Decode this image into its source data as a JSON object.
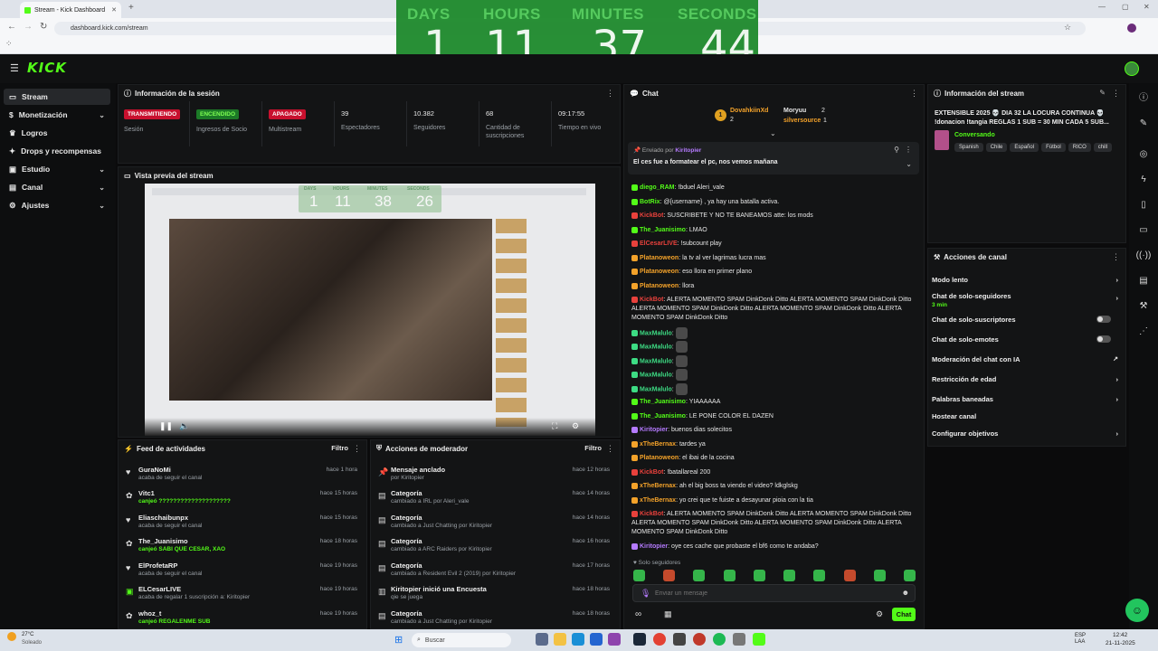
{
  "browser": {
    "tab_title": "Stream - Kick Dashboard",
    "url": "dashboard.kick.com/stream"
  },
  "timer": {
    "labels": [
      "DAYS",
      "HOURS",
      "MINUTES",
      "SECONDS"
    ],
    "values": [
      "1",
      "11",
      "37",
      "44"
    ]
  },
  "logo": "KICK",
  "sidebar": {
    "items": [
      {
        "label": "Stream"
      },
      {
        "label": "Monetización"
      },
      {
        "label": "Logros"
      },
      {
        "label": "Drops y recompensas"
      },
      {
        "label": "Estudio"
      },
      {
        "label": "Canal"
      },
      {
        "label": "Ajustes"
      }
    ]
  },
  "session": {
    "title": "Información de la sesión",
    "cols": [
      {
        "badge": "TRANSMITIENDO",
        "label": "Sesión"
      },
      {
        "badge": "ENCENDIDO",
        "label": "Ingresos de Socio"
      },
      {
        "badge": "APAGADO",
        "label": "Multistream"
      },
      {
        "value": "39",
        "label": "Espectadores"
      },
      {
        "value": "10.382",
        "label": "Seguidores"
      },
      {
        "value": "68",
        "label": "Cantidad de suscripciones"
      },
      {
        "value": "09:17:55",
        "label": "Tiempo en vivo"
      }
    ]
  },
  "preview": {
    "title": "Vista previa del stream",
    "mini_timer": [
      "1",
      "11",
      "38",
      "26"
    ],
    "mini_labels": [
      "DAYS",
      "HOURS",
      "MINUTES",
      "SECONDS"
    ]
  },
  "activity": {
    "title": "Feed de actividades",
    "filter": "Filtro",
    "rows": [
      {
        "name": "GuraNoMi",
        "sub": "acaba de seguir el canal",
        "time": "hace 1 hora"
      },
      {
        "name": "Vitc1",
        "sub": "canjeó ????????????????????",
        "time": "hace 15 horas"
      },
      {
        "name": "Eliaschaibunpx",
        "sub": "acaba de seguir el canal",
        "time": "hace 15 horas"
      },
      {
        "name": "The_Juanisimo",
        "sub": "canjeó SABI QUE CESAR, XAO",
        "time": "hace 18 horas"
      },
      {
        "name": "ElProfetaRP",
        "sub": "acaba de seguir el canal",
        "time": "hace 19 horas"
      },
      {
        "name": "ELCesarLIVE",
        "sub": "acaba de regalar 1 suscripción a: Kiritopier",
        "time": "hace 19 horas"
      },
      {
        "name": "whoz_t",
        "sub": "canjeó REGALENME SUB",
        "time": "hace 19 horas"
      }
    ]
  },
  "modactions": {
    "title": "Acciones de moderador",
    "filter": "Filtro",
    "rows": [
      {
        "name": "Mensaje anclado",
        "sub": "por Kiritopier",
        "time": "hace 12 horas"
      },
      {
        "name": "Categoría",
        "sub": "cambiado a IRL por Aleri_vale",
        "time": "hace 14 horas"
      },
      {
        "name": "Categoría",
        "sub": "cambiado a Just Chatting por Kiritopier",
        "time": "hace 14 horas"
      },
      {
        "name": "Categoría",
        "sub": "cambiado a ARC Raiders por Kiritopier",
        "time": "hace 16 horas"
      },
      {
        "name": "Categoría",
        "sub": "cambiado a Resident Evil 2 (2019) por Kiritopier",
        "time": "hace 17 horas"
      },
      {
        "name": "Kiritopier inició una Encuesta",
        "sub": "qie se juega",
        "time": "hace 18 horas"
      },
      {
        "name": "Categoría",
        "sub": "cambiado a Just Chatting por Kiritopier",
        "time": "hace 18 horas"
      }
    ]
  },
  "chat": {
    "title": "Chat",
    "top": [
      {
        "name": "DovahkiinXd",
        "count": "2"
      },
      {
        "name": "Moryuu",
        "count": "2"
      },
      {
        "name": "silversource",
        "count": "1"
      }
    ],
    "pinned": {
      "by": "Enviado por",
      "user": "Kiritopier",
      "text": "El ces fue a formatear el pc, nos vemos mañana"
    },
    "messages": [
      {
        "user": "diego_RAM",
        "color": "#53fc18",
        "text": "!bduel Aleri_vale"
      },
      {
        "user": "BotRix",
        "color": "#53fc18",
        "text": "@{username} , ya hay una batalla activa."
      },
      {
        "user": "KickBot",
        "color": "#e8413c",
        "text": "SUSCRIBETE Y NO TE BANEAMOS atte: los mods"
      },
      {
        "user": "The_Juanisimo",
        "color": "#53fc18",
        "text": "LMAO"
      },
      {
        "user": "ElCesarLIVE",
        "color": "#e8413c",
        "text": "!subcount play"
      },
      {
        "user": "Platanoweon",
        "color": "#f3a22a",
        "text": "la tv al ver lagrimas lucra mas"
      },
      {
        "user": "Platanoweon",
        "color": "#f3a22a",
        "text": "eso llora en primer plano"
      },
      {
        "user": "Platanoweon",
        "color": "#f3a22a",
        "text": "llora"
      },
      {
        "user": "KickBot",
        "color": "#e8413c",
        "text": "ALERTA MOMENTO SPAM DinkDonk Ditto ALERTA MOMENTO SPAM DinkDonk Ditto ALERTA MOMENTO SPAM DinkDonk Ditto ALERTA MOMENTO SPAM DinkDonk Ditto ALERTA MOMENTO SPAM DinkDonk Ditto"
      },
      {
        "user": "MaxMalulo",
        "color": "#3ddc84",
        "text": ""
      },
      {
        "user": "MaxMalulo",
        "color": "#3ddc84",
        "text": ""
      },
      {
        "user": "MaxMalulo",
        "color": "#3ddc84",
        "text": ""
      },
      {
        "user": "MaxMalulo",
        "color": "#3ddc84",
        "text": ""
      },
      {
        "user": "MaxMalulo",
        "color": "#3ddc84",
        "text": ""
      },
      {
        "user": "The_Juanisimo",
        "color": "#53fc18",
        "text": "YIAAAAAA"
      },
      {
        "user": "The_Juanisimo",
        "color": "#53fc18",
        "text": "LE PONE COLOR EL DAZEN"
      },
      {
        "user": "Kiritopier",
        "color": "#b57bff",
        "text": "buenos dias solecitos"
      },
      {
        "user": "xTheBernax",
        "color": "#f3a22a",
        "text": "tardes ya"
      },
      {
        "user": "Platanoweon",
        "color": "#f3a22a",
        "text": "el ibai de la cocina"
      },
      {
        "user": "KickBot",
        "color": "#e8413c",
        "text": "!batallareal 200"
      },
      {
        "user": "xTheBernax",
        "color": "#f3a22a",
        "text": "ah el big boss ta viendo el video? ldkglskg"
      },
      {
        "user": "xTheBernax",
        "color": "#f3a22a",
        "text": "yo crei que te fuiste a desayunar pioia con la tia"
      },
      {
        "user": "KickBot",
        "color": "#e8413c",
        "text": "ALERTA MOMENTO SPAM DinkDonk Ditto ALERTA MOMENTO SPAM DinkDonk Ditto ALERTA MOMENTO SPAM DinkDonk Ditto ALERTA MOMENTO SPAM DinkDonk Ditto ALERTA MOMENTO SPAM DinkDonk Ditto"
      },
      {
        "user": "Kiritopier",
        "color": "#b57bff",
        "text": "oye ces cache que probaste el bf6 como te andaba?"
      }
    ],
    "mode": "Solo seguidores",
    "placeholder": "Enviar un mensaje",
    "send": "Chat"
  },
  "info": {
    "title": "Información del stream",
    "stream_title": "EXTENSIBLE 2025 💀 DIA 32 LA LOCURA CONTINUA 💀 !donacion !tangia REGLAS 1 SUB = 30 MIN CADA 5 SUB...",
    "category": "Conversando",
    "tags": [
      "Spanish",
      "Chile",
      "Español",
      "Fútbol",
      "RICO",
      "chill"
    ]
  },
  "channel_actions": {
    "title": "Acciones de canal",
    "items": [
      {
        "label": "Modo lento",
        "ctl": "arrow"
      },
      {
        "label": "Chat de solo-seguidores",
        "sub": "3 min",
        "ctl": "arrow"
      },
      {
        "label": "Chat de solo-suscriptores",
        "ctl": "toggle"
      },
      {
        "label": "Chat de solo-emotes",
        "ctl": "toggle"
      },
      {
        "label": "Moderación del chat con IA",
        "ctl": "ext"
      },
      {
        "label": "Restricción de edad",
        "ctl": "arrow"
      },
      {
        "label": "Palabras baneadas",
        "ctl": "arrow"
      },
      {
        "label": "Hostear canal",
        "ctl": ""
      },
      {
        "label": "Configurar objetivos",
        "ctl": "arrow"
      }
    ]
  },
  "taskbar": {
    "temp": "27°C",
    "weather": "Soleado",
    "search": "Buscar",
    "lang": "ESP LAA",
    "time": "12:42",
    "date": "21-11-2025"
  },
  "colors": {
    "accent": "#53fc18",
    "live_red": "#c8102e",
    "timer_green": "#1e8a2c"
  }
}
